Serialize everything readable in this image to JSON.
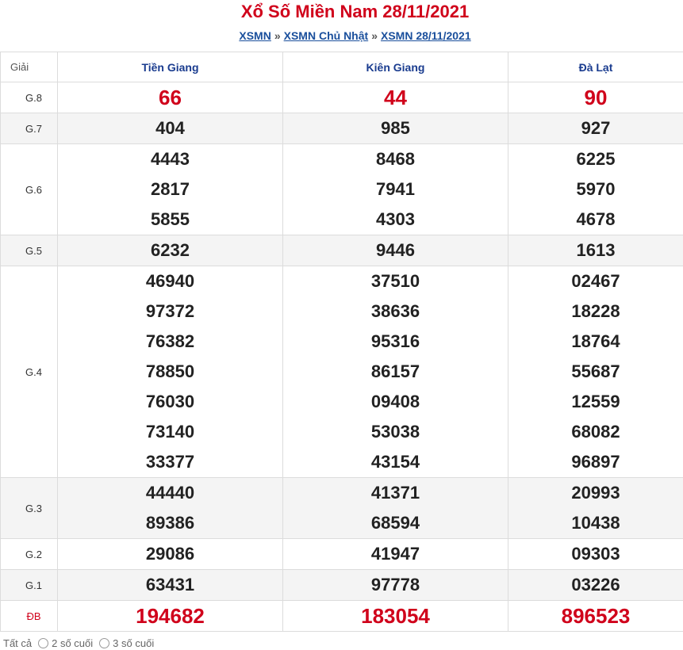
{
  "header": {
    "title": "Xổ Số Miền Nam 28/11/2021",
    "breadcrumb": [
      {
        "label": "XSMN"
      },
      {
        "label": "XSMN Chủ Nhật"
      },
      {
        "label": "XSMN 28/11/2021"
      }
    ],
    "separator": "»"
  },
  "table": {
    "label_header": "Giải",
    "provinces": [
      "Tiền Giang",
      "Kiên Giang",
      "Đà Lạt"
    ],
    "prizes": [
      {
        "label": "G.8",
        "shaded": false,
        "highlight": true,
        "values": [
          [
            "66"
          ],
          [
            "44"
          ],
          [
            "90"
          ]
        ]
      },
      {
        "label": "G.7",
        "shaded": true,
        "highlight": false,
        "values": [
          [
            "404"
          ],
          [
            "985"
          ],
          [
            "927"
          ]
        ]
      },
      {
        "label": "G.6",
        "shaded": false,
        "highlight": false,
        "values": [
          [
            "4443",
            "2817",
            "5855"
          ],
          [
            "8468",
            "7941",
            "4303"
          ],
          [
            "6225",
            "5970",
            "4678"
          ]
        ]
      },
      {
        "label": "G.5",
        "shaded": true,
        "highlight": false,
        "values": [
          [
            "6232"
          ],
          [
            "9446"
          ],
          [
            "1613"
          ]
        ]
      },
      {
        "label": "G.4",
        "shaded": false,
        "highlight": false,
        "values": [
          [
            "46940",
            "97372",
            "76382",
            "78850",
            "76030",
            "73140",
            "33377"
          ],
          [
            "37510",
            "38636",
            "95316",
            "86157",
            "09408",
            "53038",
            "43154"
          ],
          [
            "02467",
            "18228",
            "18764",
            "55687",
            "12559",
            "68082",
            "96897"
          ]
        ]
      },
      {
        "label": "G.3",
        "shaded": true,
        "highlight": false,
        "values": [
          [
            "44440",
            "89386"
          ],
          [
            "41371",
            "68594"
          ],
          [
            "20993",
            "10438"
          ]
        ]
      },
      {
        "label": "G.2",
        "shaded": false,
        "highlight": false,
        "values": [
          [
            "29086"
          ],
          [
            "41947"
          ],
          [
            "09303"
          ]
        ]
      },
      {
        "label": "G.1",
        "shaded": true,
        "highlight": false,
        "values": [
          [
            "63431"
          ],
          [
            "97778"
          ],
          [
            "03226"
          ]
        ]
      },
      {
        "label": "ĐB",
        "shaded": false,
        "highlight": true,
        "special": true,
        "values": [
          [
            "194682"
          ],
          [
            "183054"
          ],
          [
            "896523"
          ]
        ]
      }
    ]
  },
  "footer": {
    "options": [
      "Tất cả",
      "2 số cuối",
      "3 số cuối"
    ]
  },
  "colors": {
    "accent_red": "#d0021b",
    "link_blue": "#1a4f9c",
    "header_blue": "#1a3c8f"
  }
}
